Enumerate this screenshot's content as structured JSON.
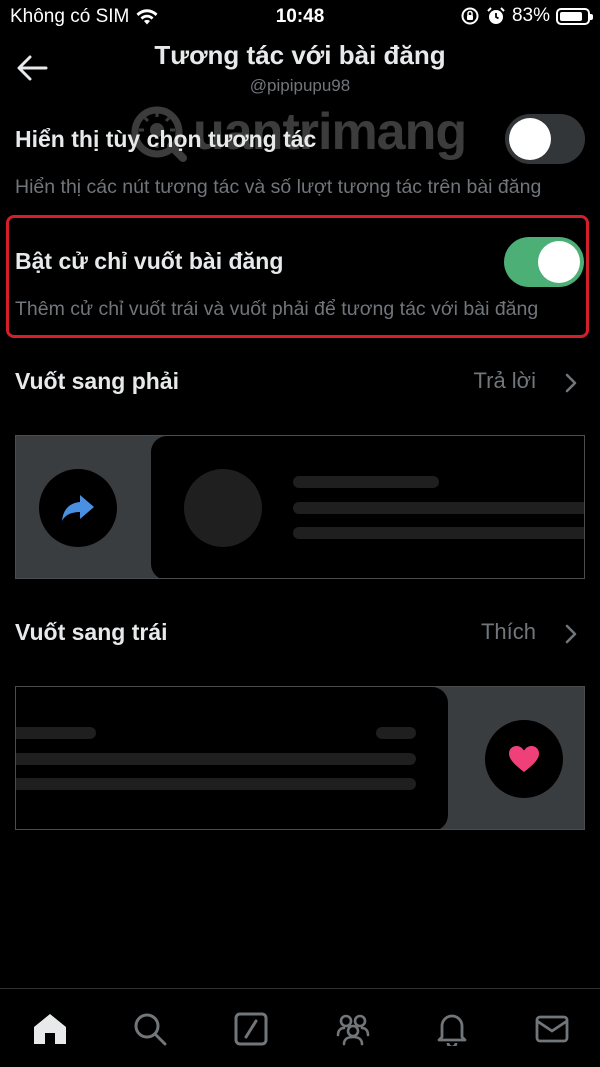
{
  "status_bar": {
    "carrier": "Không có SIM",
    "time": "10:48",
    "battery_percent": "83%",
    "battery_level": 0.83
  },
  "header": {
    "title": "Tương tác với bài đăng",
    "username": "@pipipupu98"
  },
  "watermark": "uantrimang",
  "settings": {
    "show_options": {
      "label": "Hiển thị tùy chọn tương tác",
      "description": "Hiển thị các nút tương tác và số lượt tương tác trên bài đăng",
      "enabled": false
    },
    "swipe_gestures": {
      "label": "Bật cử chỉ vuốt bài đăng",
      "description": "Thêm cử chỉ vuốt trái và vuốt phải để tương tác với bài đăng",
      "enabled": true
    }
  },
  "swipe_right": {
    "label": "Vuốt sang phải",
    "value": "Trả lời",
    "icon": "reply-arrow-icon"
  },
  "swipe_left": {
    "label": "Vuốt sang trái",
    "value": "Thích",
    "icon": "heart-icon"
  },
  "tabs": [
    "home-icon",
    "search-icon",
    "compose-icon",
    "communities-icon",
    "notifications-icon",
    "messages-icon"
  ],
  "colors": {
    "background": "#000000",
    "text_primary": "#e7e9ea",
    "text_secondary": "#71767b",
    "toggle_on": "#4caf76",
    "toggle_off": "#333639",
    "highlight": "#d21f2a",
    "reply_icon": "#4a90e2",
    "heart_icon": "#f0407a"
  }
}
